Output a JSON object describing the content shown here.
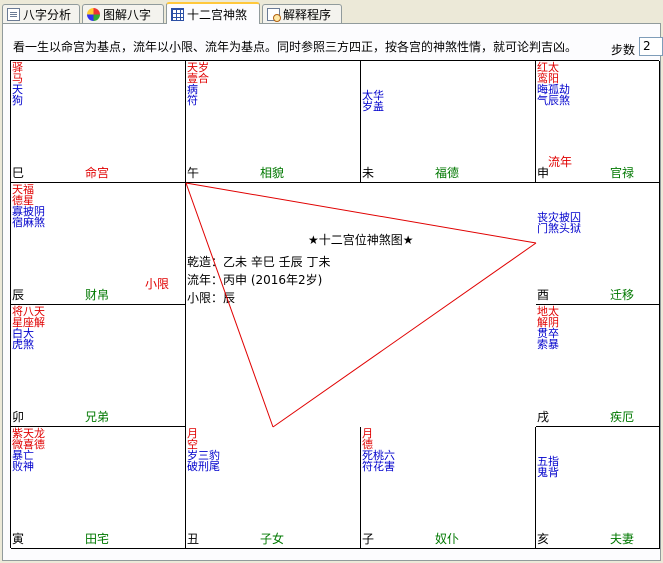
{
  "tabs": [
    {
      "label": "八字分析",
      "icon": "document-icon"
    },
    {
      "label": "图解八字",
      "icon": "color-wheel-icon"
    },
    {
      "label": "十二宫神煞",
      "icon": "grid-icon"
    },
    {
      "label": "解释程序",
      "icon": "magnify-document-icon"
    }
  ],
  "intro_text": "看一生以命宫为基点，流年以小限、流年为基点。同时参照三方四正，按各宫的神煞性情，就可论判吉凶。",
  "stepper": {
    "label": "步数",
    "value": "2岁"
  },
  "palaces": [
    {
      "branch": "巳",
      "name": "命宫",
      "name_color": "#e00000",
      "red": [
        "驿",
        "马"
      ],
      "blue": [
        "天",
        "狗"
      ],
      "extra": ""
    },
    {
      "branch": "午",
      "name": "相貌",
      "name_color": "#007800",
      "red": [
        "天岁",
        "壹合"
      ],
      "blue": [
        "病",
        "符"
      ],
      "extra": ""
    },
    {
      "branch": "未",
      "name": "福德",
      "name_color": "#007800",
      "red": [],
      "blue": [
        "太华",
        "岁盖"
      ],
      "extra": ""
    },
    {
      "branch": "申",
      "name": "官禄",
      "name_color": "#007800",
      "red": [
        "红太",
        "鸾阳"
      ],
      "blue": [
        "晦孤劫",
        "气辰煞"
      ],
      "extra": "流年"
    },
    {
      "branch": "辰",
      "name": "财帛",
      "name_color": "#007800",
      "red": [
        "天福",
        "德星"
      ],
      "blue": [
        "寡披阴",
        "宿麻煞"
      ],
      "extra": "小限"
    },
    {
      "branch": "酉",
      "name": "迁移",
      "name_color": "#007800",
      "red": [],
      "blue": [
        "丧灾披囚",
        "门煞头狱"
      ],
      "extra": ""
    },
    {
      "branch": "卯",
      "name": "兄弟",
      "name_color": "#007800",
      "red": [
        "将八天",
        "星座解"
      ],
      "blue": [
        "白大",
        "虎煞"
      ],
      "extra": ""
    },
    {
      "branch": "戌",
      "name": "疾厄",
      "name_color": "#007800",
      "red": [
        "地太",
        "解阴"
      ],
      "blue": [
        "贯卒",
        "索暴"
      ],
      "extra": ""
    },
    {
      "branch": "寅",
      "name": "田宅",
      "name_color": "#007800",
      "red": [
        "紫天龙",
        "微喜德"
      ],
      "blue": [
        "暴亡",
        "败神"
      ],
      "extra": ""
    },
    {
      "branch": "丑",
      "name": "子女",
      "name_color": "#007800",
      "red": [
        "月",
        "空"
      ],
      "blue": [
        "岁三豹",
        "破刑尾"
      ],
      "extra": ""
    },
    {
      "branch": "子",
      "name": "奴仆",
      "name_color": "#007800",
      "red": [
        "月",
        "德"
      ],
      "blue": [
        "死桃六",
        "符花害"
      ],
      "extra": ""
    },
    {
      "branch": "亥",
      "name": "夫妻",
      "name_color": "#007800",
      "red": [],
      "blue": [
        "五指",
        "鬼背"
      ],
      "extra": ""
    }
  ],
  "center": {
    "title": "★十二宫位神煞图★",
    "qianzao": "乾造：乙未  辛巳  壬辰  丁未",
    "liunian": "流年：丙申 (2016年2岁)",
    "xiaoxian": "小限：辰"
  },
  "colors": {
    "red": "#e00000",
    "blue": "#0000cc",
    "green": "#007800",
    "line": "#e00000"
  }
}
